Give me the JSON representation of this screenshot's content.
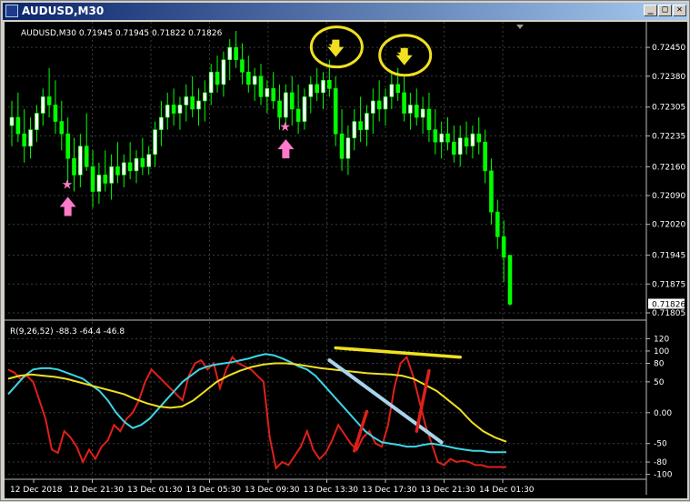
{
  "window": {
    "title": "AUDUSD,M30",
    "buttons": {
      "minimize": "_",
      "maximize": "□",
      "close": "✕"
    }
  },
  "colors": {
    "background": "#000000",
    "grid": "#3c3c3c",
    "bull_candle": "#ffffff",
    "bear_candle": "#00ff00",
    "red_line": "#e0201a",
    "cyan_line": "#3cd6e6",
    "yellow_line": "#f0e020",
    "pink_marker": "#ff7ac8",
    "yellow_marker": "#f0e020",
    "light_blue_trend": "#a8d4ec"
  },
  "price_panel": {
    "header": "AUDUSD,M30  0.71945 0.71945 0.71822 0.71826",
    "current_price": "0.71826",
    "y_ticks": [
      "0.72450",
      "0.72380",
      "0.72305",
      "0.72235",
      "0.72160",
      "0.72090",
      "0.72020",
      "0.71945",
      "0.71875",
      "0.71805"
    ]
  },
  "indicator_panel": {
    "header": "R(9,26,52) -88.3 -64.4 -46.8",
    "y_ticks": [
      "120",
      "100",
      "80",
      "50",
      "0.00",
      "-50",
      "-80",
      "-100"
    ]
  },
  "x_ticks": [
    "12 Dec 2018",
    "12 Dec 21:30",
    "13 Dec 01:30",
    "13 Dec 05:30",
    "13 Dec 09:30",
    "13 Dec 13:30",
    "13 Dec 17:30",
    "13 Dec 21:30",
    "14 Dec 01:30"
  ],
  "chart_data": {
    "type": "candlestick",
    "symbol": "AUDUSD",
    "timeframe": "M30",
    "price_ylim": [
      0.71805,
      0.7249
    ],
    "ohlc_last": {
      "open": 0.71945,
      "high": 0.71945,
      "low": 0.71822,
      "close": 0.71826
    },
    "candles": [
      [
        0.7226,
        0.7232,
        0.7221,
        0.7228
      ],
      [
        0.7228,
        0.7234,
        0.7222,
        0.7224
      ],
      [
        0.7224,
        0.723,
        0.7217,
        0.7221
      ],
      [
        0.7221,
        0.7228,
        0.7218,
        0.7225
      ],
      [
        0.7225,
        0.7231,
        0.7222,
        0.7229
      ],
      [
        0.7229,
        0.7235,
        0.7226,
        0.7233
      ],
      [
        0.7233,
        0.724,
        0.7228,
        0.7231
      ],
      [
        0.7231,
        0.7237,
        0.7224,
        0.7227
      ],
      [
        0.7227,
        0.7232,
        0.722,
        0.7224
      ],
      [
        0.7224,
        0.7228,
        0.7212,
        0.7218
      ],
      [
        0.7218,
        0.7223,
        0.721,
        0.7214
      ],
      [
        0.7214,
        0.7224,
        0.7211,
        0.7221
      ],
      [
        0.7221,
        0.7229,
        0.7215,
        0.7216
      ],
      [
        0.7216,
        0.722,
        0.7206,
        0.721
      ],
      [
        0.721,
        0.7217,
        0.7207,
        0.7214
      ],
      [
        0.7214,
        0.722,
        0.721,
        0.7212
      ],
      [
        0.7212,
        0.7219,
        0.7208,
        0.7216
      ],
      [
        0.7216,
        0.7222,
        0.7212,
        0.7214
      ],
      [
        0.7214,
        0.7219,
        0.7211,
        0.7217
      ],
      [
        0.7217,
        0.7222,
        0.7213,
        0.7215
      ],
      [
        0.7215,
        0.722,
        0.7212,
        0.7218
      ],
      [
        0.7218,
        0.7223,
        0.7214,
        0.7216
      ],
      [
        0.7216,
        0.7221,
        0.7214,
        0.7219
      ],
      [
        0.7219,
        0.7227,
        0.7216,
        0.7225
      ],
      [
        0.7225,
        0.7232,
        0.7221,
        0.7228
      ],
      [
        0.7228,
        0.7234,
        0.7225,
        0.7231
      ],
      [
        0.7231,
        0.7235,
        0.7226,
        0.7229
      ],
      [
        0.7229,
        0.7233,
        0.7225,
        0.7231
      ],
      [
        0.7231,
        0.7236,
        0.7227,
        0.7233
      ],
      [
        0.7233,
        0.7238,
        0.7228,
        0.723
      ],
      [
        0.723,
        0.7235,
        0.7226,
        0.7232
      ],
      [
        0.7232,
        0.7237,
        0.7227,
        0.7234
      ],
      [
        0.7234,
        0.7241,
        0.7231,
        0.7239
      ],
      [
        0.7239,
        0.7243,
        0.7234,
        0.7236
      ],
      [
        0.7236,
        0.7244,
        0.7233,
        0.7242
      ],
      [
        0.7242,
        0.7247,
        0.7237,
        0.7245
      ],
      [
        0.7245,
        0.7249,
        0.724,
        0.7242
      ],
      [
        0.7242,
        0.7246,
        0.7236,
        0.7239
      ],
      [
        0.7239,
        0.7243,
        0.7234,
        0.7236
      ],
      [
        0.7236,
        0.724,
        0.7232,
        0.7238
      ],
      [
        0.7238,
        0.7241,
        0.7231,
        0.7233
      ],
      [
        0.7233,
        0.7237,
        0.7229,
        0.7235
      ],
      [
        0.7235,
        0.7239,
        0.723,
        0.7232
      ],
      [
        0.7232,
        0.7236,
        0.7225,
        0.7228
      ],
      [
        0.7228,
        0.7236,
        0.7226,
        0.7234
      ],
      [
        0.7234,
        0.7238,
        0.7226,
        0.723
      ],
      [
        0.723,
        0.7236,
        0.7224,
        0.7227
      ],
      [
        0.7227,
        0.7235,
        0.7225,
        0.7233
      ],
      [
        0.7233,
        0.7238,
        0.7229,
        0.7236
      ],
      [
        0.7236,
        0.724,
        0.7232,
        0.7234
      ],
      [
        0.7234,
        0.7239,
        0.723,
        0.7237
      ],
      [
        0.7237,
        0.7242,
        0.7233,
        0.7235
      ],
      [
        0.7235,
        0.7238,
        0.7221,
        0.7224
      ],
      [
        0.7224,
        0.723,
        0.7215,
        0.7218
      ],
      [
        0.7218,
        0.7226,
        0.7214,
        0.7223
      ],
      [
        0.7223,
        0.723,
        0.722,
        0.7227
      ],
      [
        0.7227,
        0.7233,
        0.7222,
        0.7225
      ],
      [
        0.7225,
        0.7231,
        0.7221,
        0.7229
      ],
      [
        0.7229,
        0.7235,
        0.7224,
        0.7232
      ],
      [
        0.7232,
        0.7237,
        0.7227,
        0.723
      ],
      [
        0.723,
        0.7235,
        0.7226,
        0.7233
      ],
      [
        0.7233,
        0.7239,
        0.723,
        0.7236
      ],
      [
        0.7236,
        0.724,
        0.7232,
        0.7234
      ],
      [
        0.7234,
        0.7238,
        0.7227,
        0.7229
      ],
      [
        0.7229,
        0.7234,
        0.7225,
        0.7231
      ],
      [
        0.7231,
        0.7235,
        0.7226,
        0.7228
      ],
      [
        0.7228,
        0.7233,
        0.7224,
        0.723
      ],
      [
        0.723,
        0.7234,
        0.7222,
        0.7225
      ],
      [
        0.7225,
        0.723,
        0.7219,
        0.7222
      ],
      [
        0.7222,
        0.7227,
        0.7218,
        0.7224
      ],
      [
        0.7224,
        0.7228,
        0.722,
        0.7222
      ],
      [
        0.7222,
        0.7226,
        0.7217,
        0.7219
      ],
      [
        0.7219,
        0.7226,
        0.7216,
        0.7223
      ],
      [
        0.7223,
        0.7227,
        0.7219,
        0.7221
      ],
      [
        0.7221,
        0.7226,
        0.7218,
        0.7224
      ],
      [
        0.7224,
        0.7228,
        0.7219,
        0.7222
      ],
      [
        0.7222,
        0.7225,
        0.7212,
        0.7215
      ],
      [
        0.7215,
        0.7218,
        0.7202,
        0.7205
      ],
      [
        0.7205,
        0.7208,
        0.7196,
        0.7199
      ],
      [
        0.7199,
        0.7203,
        0.7188,
        0.7194
      ],
      [
        0.71945,
        0.71945,
        0.71822,
        0.71826
      ]
    ],
    "arrows": [
      {
        "type": "up",
        "color": "#ff7ac8",
        "index": 9
      },
      {
        "type": "up",
        "color": "#ff7ac8",
        "index": 44
      },
      {
        "type": "down",
        "color": "#f0e020",
        "index": 51
      },
      {
        "type": "down",
        "color": "#f0e020",
        "index": 62
      }
    ],
    "indicator": {
      "name": "R(9,26,52)",
      "ylim": [
        -105,
        125
      ],
      "levels": [
        100,
        80,
        50,
        0,
        -50,
        -80,
        -100
      ],
      "series": [
        {
          "color": "#e0201a",
          "values": [
            70,
            65,
            55,
            60,
            50,
            20,
            -10,
            -60,
            -65,
            -30,
            -40,
            -55,
            -80,
            -60,
            -75,
            -55,
            -45,
            -20,
            -30,
            -10,
            0,
            20,
            50,
            70,
            60,
            50,
            40,
            30,
            20,
            60,
            80,
            85,
            70,
            80,
            40,
            70,
            90,
            80,
            75,
            70,
            60,
            50,
            -40,
            -90,
            -80,
            -85,
            -70,
            -55,
            -30,
            -60,
            -75,
            -65,
            -45,
            -20,
            -35,
            -50,
            -60,
            -40,
            -30,
            -50,
            -55,
            -20,
            40,
            80,
            90,
            60,
            20,
            -20,
            -50,
            -80,
            -85,
            -75,
            -80,
            -78,
            -80,
            -85,
            -85,
            -88,
            -88,
            -88,
            -88
          ]
        },
        {
          "color": "#3cd6e6",
          "values": [
            30,
            45,
            60,
            70,
            72,
            72,
            70,
            65,
            60,
            55,
            45,
            35,
            20,
            0,
            -15,
            -25,
            -20,
            -10,
            5,
            20,
            35,
            50,
            60,
            70,
            75,
            78,
            80,
            82,
            85,
            88,
            92,
            95,
            93,
            88,
            82,
            75,
            70,
            60,
            45,
            30,
            15,
            0,
            -15,
            -30,
            -40,
            -48,
            -50,
            -52,
            -55,
            -55,
            -52,
            -50,
            -52,
            -55,
            -58,
            -60,
            -62,
            -62,
            -64,
            -64,
            -64
          ]
        },
        {
          "color": "#f0e020",
          "values": [
            55,
            60,
            62,
            60,
            58,
            55,
            50,
            45,
            40,
            35,
            30,
            22,
            15,
            10,
            8,
            10,
            20,
            35,
            50,
            60,
            68,
            74,
            78,
            80,
            80,
            78,
            75,
            72,
            70,
            68,
            66,
            64,
            63,
            62,
            60,
            55,
            45,
            35,
            20,
            5,
            -15,
            -30,
            -40,
            -47
          ]
        }
      ]
    },
    "annotations": [
      {
        "type": "line",
        "color": "#f0e020",
        "from": [
          52,
          105
        ],
        "to": [
          72,
          90
        ]
      },
      {
        "type": "line",
        "color": "#a8d4ec",
        "from": [
          51,
          85
        ],
        "to": [
          69,
          -48
        ]
      },
      {
        "type": "line",
        "color": "#e0201a",
        "from": [
          55,
          -62
        ],
        "to": [
          57,
          2
        ]
      },
      {
        "type": "line",
        "color": "#e0201a",
        "from": [
          65,
          -30
        ],
        "to": [
          67,
          68
        ]
      }
    ]
  }
}
